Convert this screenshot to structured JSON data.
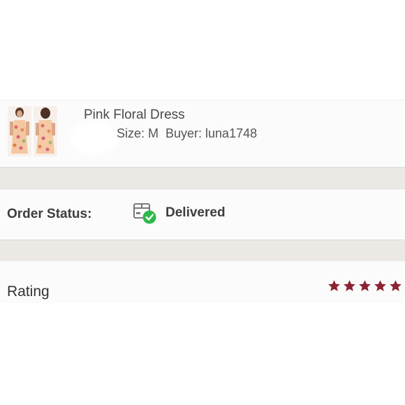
{
  "item": {
    "title": "Pink Floral Dress",
    "size": "Size: M",
    "buyer": "Buyer: luna1748",
    "thumbnail_icons": [
      "dress-photo-front-icon",
      "dress-photo-back-icon"
    ]
  },
  "order": {
    "status_label": "Order Status:",
    "status_value": "Delivered",
    "status_icon": "package-delivered-icon",
    "status_color": "#2eb84b"
  },
  "rating": {
    "label": "Rating",
    "stars": 5,
    "max_stars": 5,
    "star_color": "#8b2332"
  },
  "colors": {
    "band": "#ece9e5",
    "card": "#fcfbfb",
    "text": "#3d3d3d"
  }
}
